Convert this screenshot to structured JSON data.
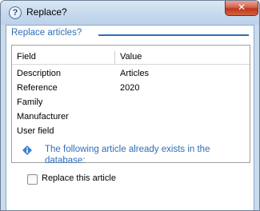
{
  "window": {
    "title": "Replace?",
    "help_icon": "question-icon",
    "close_label": "✕"
  },
  "group": {
    "title": "Replace articles?"
  },
  "table": {
    "columns": [
      "Field",
      "Value"
    ],
    "rows": [
      {
        "field": "Description",
        "value": "Articles"
      },
      {
        "field": "Reference",
        "value": "2020"
      },
      {
        "field": "Family",
        "value": ""
      },
      {
        "field": "Manufacturer",
        "value": ""
      },
      {
        "field": "User field",
        "value": ""
      }
    ]
  },
  "message": {
    "icon": "info-icon",
    "text": "The following article already exists in the database:"
  },
  "option": {
    "label": "Replace this article",
    "checked": false
  },
  "colors": {
    "accent": "#2e6fb7",
    "close": "#c0351c"
  }
}
